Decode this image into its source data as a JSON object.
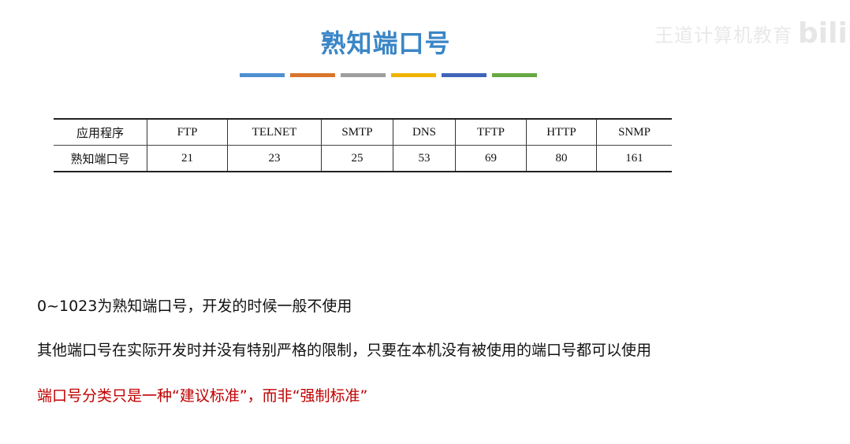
{
  "title": "熟知端口号",
  "colors": {
    "title": "#3b86c6",
    "bars": [
      "#4f8fd0",
      "#d9742b",
      "#9e9e9e",
      "#f0b400",
      "#3f63b8",
      "#66a843"
    ],
    "emphasis": "#c00000"
  },
  "watermark": {
    "text": "王道计算机教育",
    "logo": "bilib"
  },
  "table": {
    "header": [
      "应用程序",
      "FTP",
      "TELNET",
      "SMTP",
      "DNS",
      "TFTP",
      "HTTP",
      "SNMP"
    ],
    "row": [
      "熟知端口号",
      "21",
      "23",
      "25",
      "53",
      "69",
      "80",
      "161"
    ]
  },
  "lines": [
    "0~1023为熟知端口号，开发的时候一般不使用",
    "其他端口号在实际开发时并没有特别严格的限制，只要在本机没有被使用的端口号都可以使用",
    "端口号分类只是一种“建议标准”，而非“强制标准”"
  ]
}
